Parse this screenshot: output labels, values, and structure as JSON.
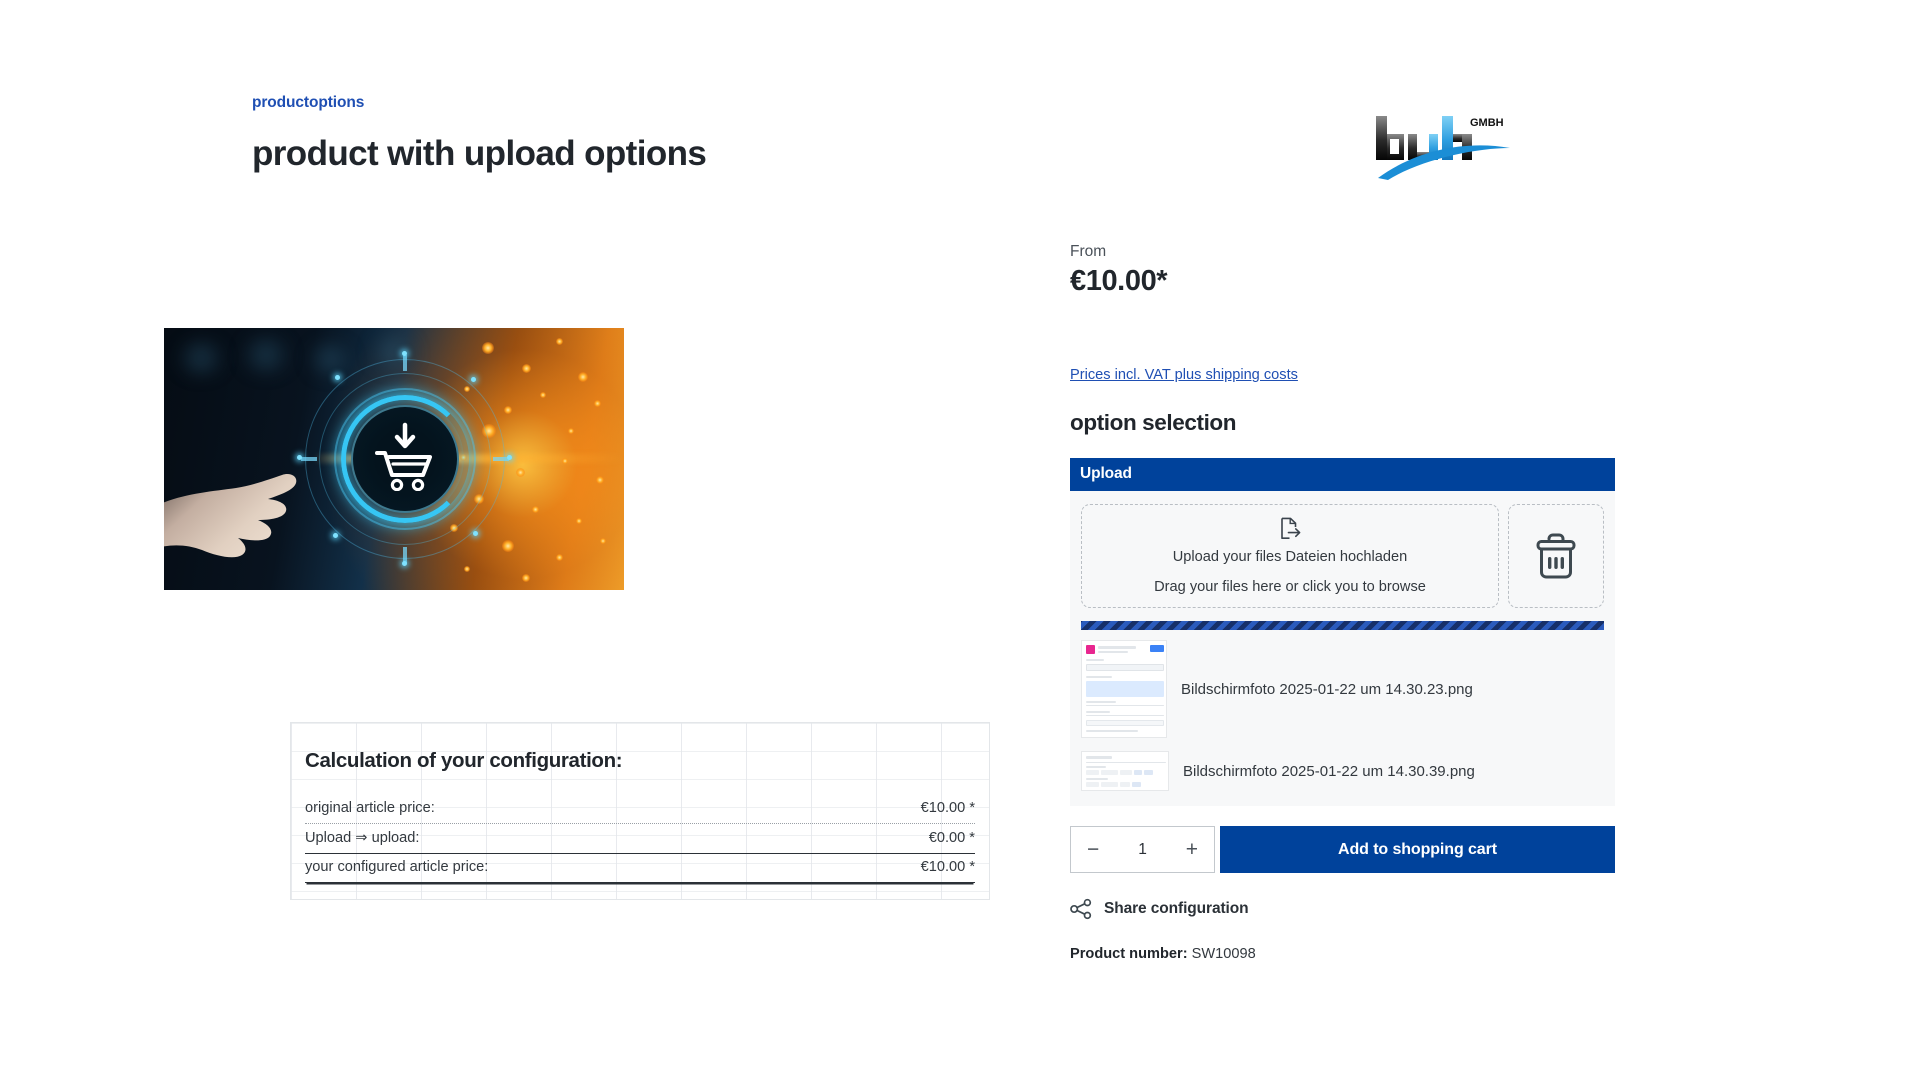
{
  "breadcrumb": {
    "label": "productoptions"
  },
  "header": {
    "title": "product with upload options"
  },
  "logo": {
    "text_dark": "bu",
    "text_light": "h",
    "suffix": "GMBH",
    "color_dark": "#111111",
    "color_light": "#2e9fe0",
    "swoosh_color": "#1b8ed6"
  },
  "product_image": {
    "alt": "hand touching glowing shopping cart technology ring"
  },
  "calculation": {
    "title": "Calculation of your configuration:",
    "rows": [
      {
        "label": "original article price:",
        "value": "€10.00 *",
        "separator": "dotted"
      },
      {
        "label": "Upload ⇒ upload:",
        "value": "€0.00 *",
        "separator": "solid"
      },
      {
        "label": "your configured article price:",
        "value": "€10.00 *",
        "separator": "double"
      }
    ]
  },
  "price": {
    "from_label": "From",
    "amount": "€10.00*",
    "vat_link": "Prices incl. VAT plus shipping costs"
  },
  "options": {
    "section_title": "option selection",
    "group_title": "Upload",
    "dropzone": {
      "icon": "file-export-icon",
      "line1": "Upload your files Dateien hochladen",
      "line2": "Drag your files here or click you to browse"
    },
    "delete_zone": {
      "icon": "trash-icon"
    },
    "progress": {
      "striped": true,
      "percent": 100,
      "color_dark": "#16306a",
      "color_light": "#2a5bbd"
    },
    "files": [
      {
        "name": "Bildschirmfoto 2025-01-22 um 14.30.23.png"
      },
      {
        "name": "Bildschirmfoto 2025-01-22 um 14.30.39.png"
      }
    ]
  },
  "buy": {
    "quantity": "1",
    "decrement_label": "−",
    "increment_label": "+",
    "add_to_cart_label": "Add to shopping cart",
    "accent_color": "#00429b"
  },
  "share": {
    "icon": "share-nodes-icon",
    "label": "Share configuration"
  },
  "product_number": {
    "label": "Product number:",
    "value": "SW10098"
  }
}
